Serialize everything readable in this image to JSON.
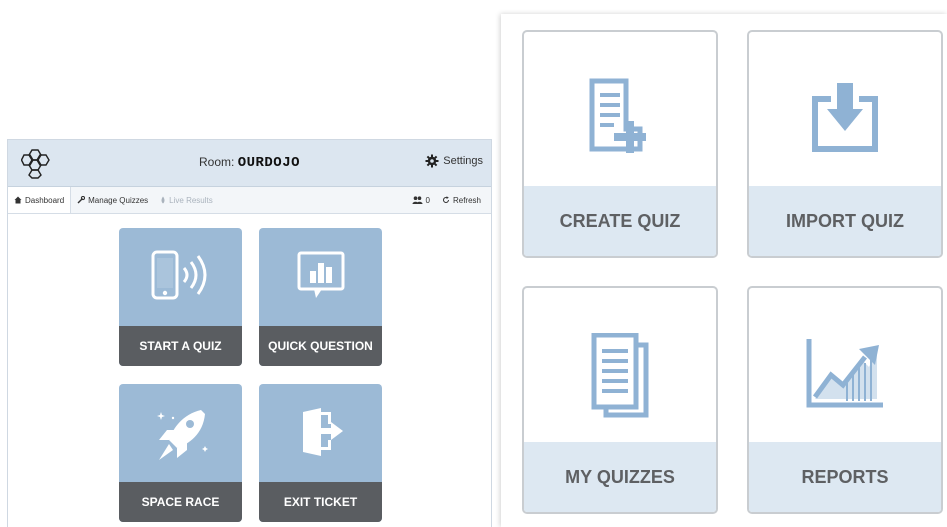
{
  "header": {
    "room_label": "Room:",
    "room_code": "OURDOJO",
    "settings_label": "Settings"
  },
  "nav": {
    "tabs": [
      {
        "label": "Dashboard",
        "icon": "home-icon"
      },
      {
        "label": "Manage Quizzes",
        "icon": "wrench-icon"
      },
      {
        "label": "Live Results",
        "icon": "live-icon"
      }
    ],
    "student_count": "0",
    "refresh_label": "Refresh"
  },
  "dashboard": {
    "tiles": [
      {
        "label": "START A QUIZ",
        "icon": "phone-signal-icon"
      },
      {
        "label": "QUICK QUESTION",
        "icon": "chart-bubble-icon"
      },
      {
        "label": "SPACE RACE",
        "icon": "rocket-icon"
      },
      {
        "label": "EXIT TICKET",
        "icon": "exit-door-icon"
      }
    ]
  },
  "quizzes": {
    "cards": [
      {
        "label": "CREATE QUIZ",
        "icon": "create-doc-icon"
      },
      {
        "label": "IMPORT QUIZ",
        "icon": "import-icon"
      },
      {
        "label": "MY QUIZZES",
        "icon": "documents-icon"
      },
      {
        "label": "REPORTS",
        "icon": "reports-chart-icon"
      }
    ]
  },
  "colors": {
    "tile_bg": "#9cbad6",
    "tile_label_bg": "#5a5d61",
    "header_bg": "#dce6f0",
    "card_icon": "#8fb2d4",
    "card_label_bg": "#dde8f2"
  }
}
